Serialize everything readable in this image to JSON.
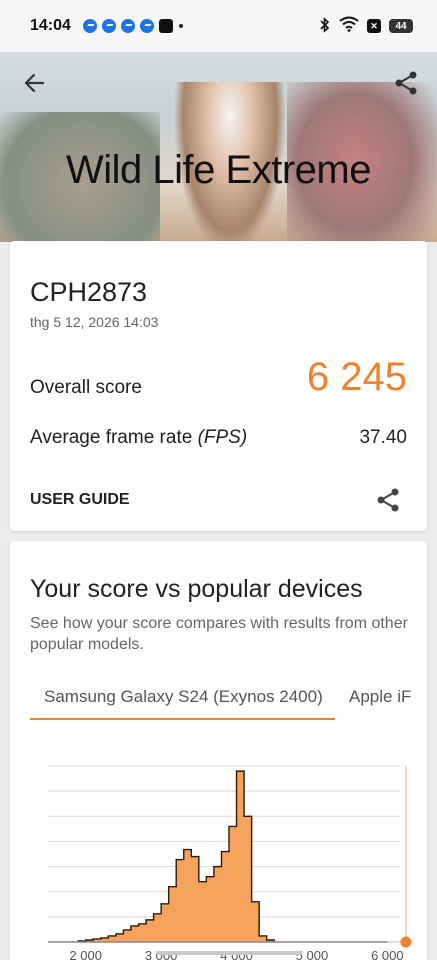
{
  "status": {
    "time": "14:04",
    "battery": "44"
  },
  "header": {
    "title": "Wild Life Extreme"
  },
  "result": {
    "device": "CPH2873",
    "datetime": "thg 5 12, 2026 14:03",
    "overall_label": "Overall score",
    "overall_value": "6 245",
    "fps_label": "Average frame rate",
    "fps_unit": "(FPS)",
    "fps_value": "37.40",
    "guide_label": "USER GUIDE"
  },
  "compare": {
    "title": "Your score vs popular devices",
    "description": "See how your score compares with results from other popular models.",
    "tabs": [
      "Samsung Galaxy S24 (Exynos 2400)",
      "Apple iF"
    ]
  },
  "colors": {
    "accent": "#f0822e",
    "histogram_fill": "#f5a35c"
  },
  "icons": [
    "back-arrow-icon",
    "share-icon",
    "messenger-icon",
    "tiktok-icon",
    "bluetooth-icon",
    "wifi-icon"
  ],
  "chart_data": {
    "type": "area",
    "x_ticks": [
      "2 000",
      "3 000",
      "4 000",
      "5 000",
      "6 000"
    ],
    "xlim": [
      1500,
      6300
    ],
    "your_score": 6245,
    "x": [
      1500,
      1600,
      1700,
      1800,
      1900,
      2000,
      2100,
      2200,
      2300,
      2400,
      2500,
      2600,
      2700,
      2800,
      2900,
      3000,
      3100,
      3200,
      3300,
      3400,
      3500,
      3600,
      3700,
      3800,
      3900,
      4000,
      4100,
      4200,
      4300,
      4400,
      4500,
      5000,
      6000
    ],
    "values": [
      0,
      0,
      0,
      0,
      1,
      2,
      3,
      4,
      6,
      8,
      12,
      16,
      18,
      22,
      28,
      38,
      55,
      82,
      92,
      85,
      60,
      65,
      75,
      90,
      115,
      170,
      125,
      40,
      6,
      2,
      0,
      0,
      0
    ]
  }
}
